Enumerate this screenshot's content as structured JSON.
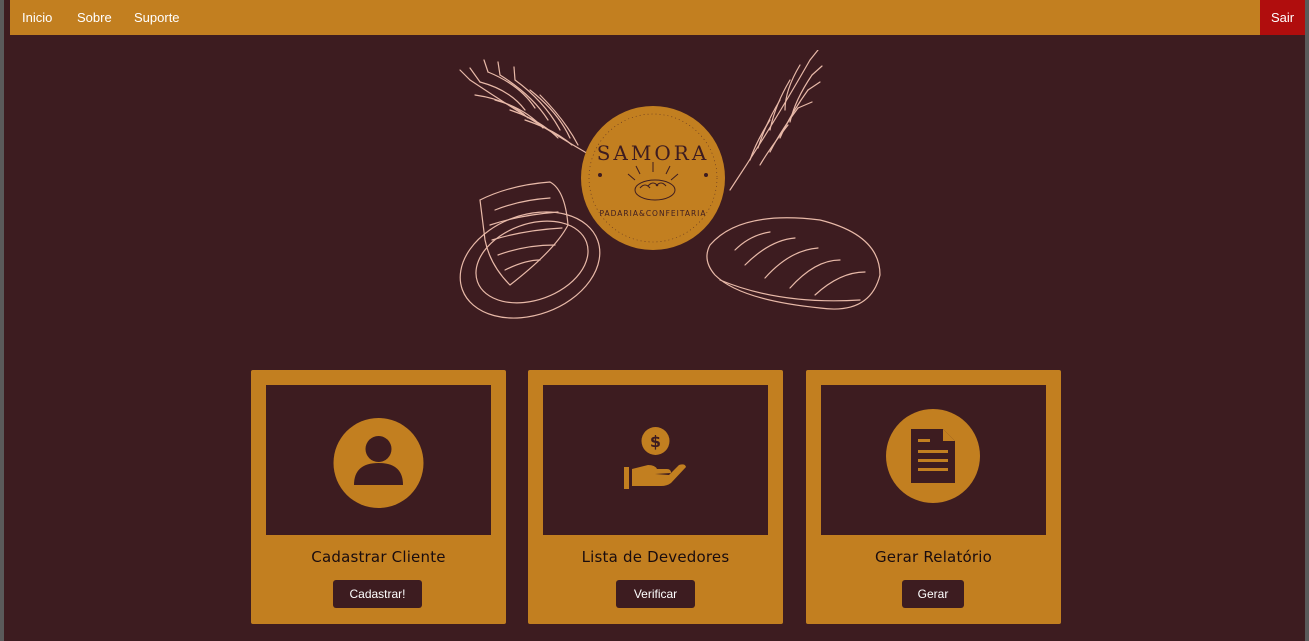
{
  "navbar": {
    "links": [
      {
        "label": "Inicio"
      },
      {
        "label": "Sobre"
      },
      {
        "label": "Suporte"
      }
    ],
    "logout_label": "Sair"
  },
  "logo": {
    "brand": "SAMORA",
    "subtitle": "PADARIA&CONFEITARIA"
  },
  "cards": [
    {
      "title": "Cadastrar Cliente",
      "button": "Cadastrar!",
      "icon": "user-icon"
    },
    {
      "title": "Lista de Devedores",
      "button": "Verificar",
      "icon": "hand-money-icon"
    },
    {
      "title": "Gerar Relatório",
      "button": "Gerar",
      "icon": "document-icon"
    }
  ],
  "colors": {
    "background": "#3d1c20",
    "accent": "#c27f20",
    "logout": "#b00d0d",
    "sketch": "#e8b9a8"
  }
}
